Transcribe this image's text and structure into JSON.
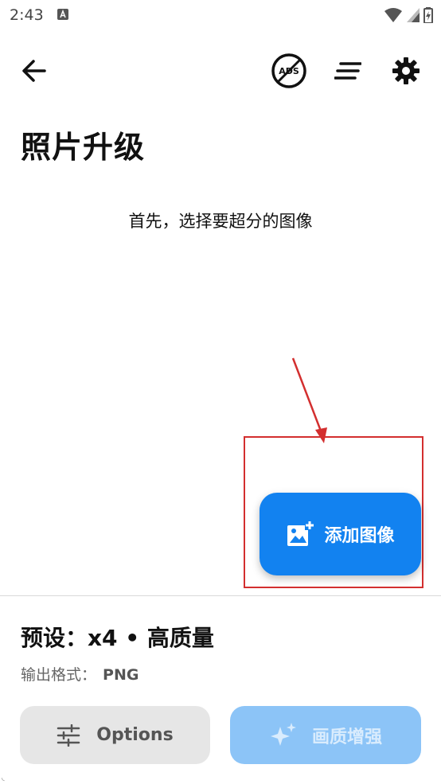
{
  "status_bar": {
    "time": "2:43"
  },
  "top_bar": {
    "icons": [
      "back-arrow-icon",
      "no-ads-icon",
      "sort-lines-icon",
      "gear-icon"
    ],
    "ads_badge": "ADS"
  },
  "page": {
    "title": "照片升级",
    "hint": "首先，选择要超分的图像"
  },
  "fab": {
    "label": "添加图像",
    "icon": "add-image-icon",
    "color": "#1282f0"
  },
  "annotation": {
    "color": "#d32f2f"
  },
  "bottom": {
    "preset": "预设：x4 • 高质量",
    "format_label": "输出格式：",
    "format_value": "PNG",
    "options_label": "Options",
    "enhance_label": "画质增强",
    "enhance_enabled": false
  }
}
